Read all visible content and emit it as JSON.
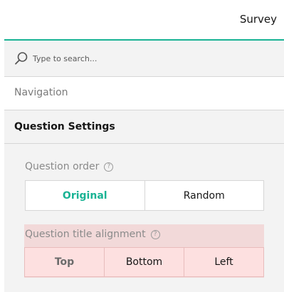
{
  "header": {
    "title": "Survey"
  },
  "search": {
    "placeholder": "Type to search..."
  },
  "nav": {
    "label": "Navigation"
  },
  "section": {
    "title": "Question Settings"
  },
  "question_order": {
    "label": "Question order",
    "help": "?",
    "options": [
      "Original",
      "Random"
    ],
    "selected": "Original"
  },
  "title_alignment": {
    "label": "Question title alignment",
    "help": "?",
    "options": [
      "Top",
      "Bottom",
      "Left"
    ],
    "selected": "Top"
  },
  "colors": {
    "accent": "#19b394",
    "error_background": "#fde0e0"
  },
  "icons": {
    "search": "search-icon",
    "help": "help-icon"
  }
}
